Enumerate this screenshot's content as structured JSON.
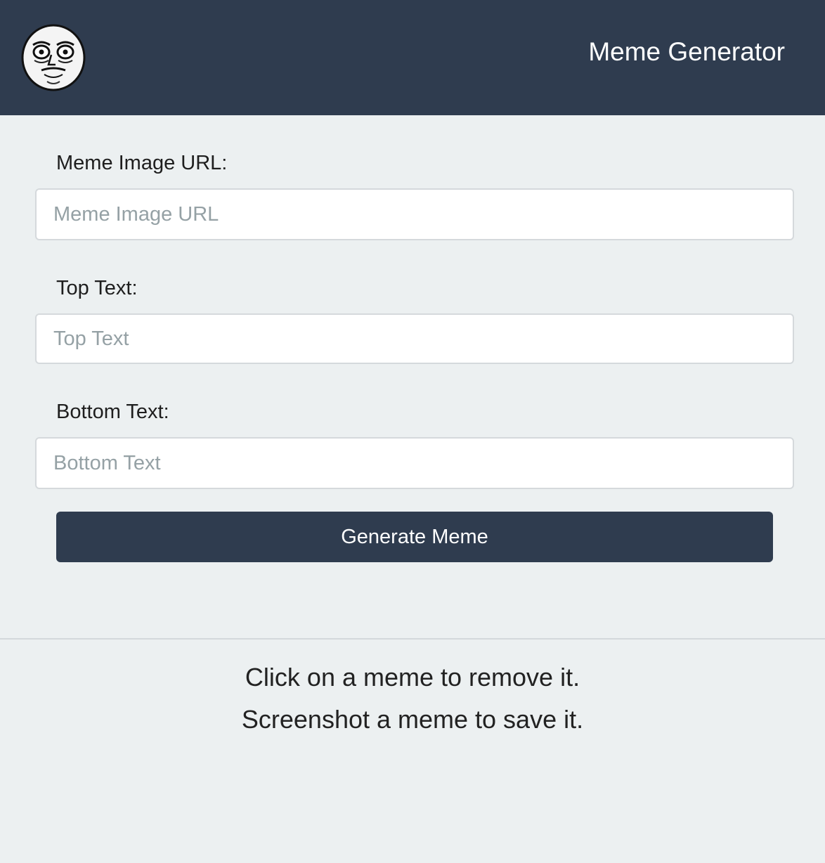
{
  "header": {
    "logo_icon": "me-gusta-face-icon",
    "title": "Meme Generator",
    "background": "#2f3c4f"
  },
  "form": {
    "image_url": {
      "label": "Meme Image URL:",
      "placeholder": "Meme Image URL",
      "value": ""
    },
    "top_text": {
      "label": "Top Text:",
      "placeholder": "Top Text",
      "value": ""
    },
    "bottom_text": {
      "label": "Bottom Text:",
      "placeholder": "Bottom Text",
      "value": ""
    },
    "submit_label": "Generate Meme"
  },
  "info": {
    "line1": "Click on a meme to remove it.",
    "line2": "Screenshot a meme to save it."
  },
  "colors": {
    "primary": "#2f3c4f",
    "page_background": "#ecf0f1"
  }
}
